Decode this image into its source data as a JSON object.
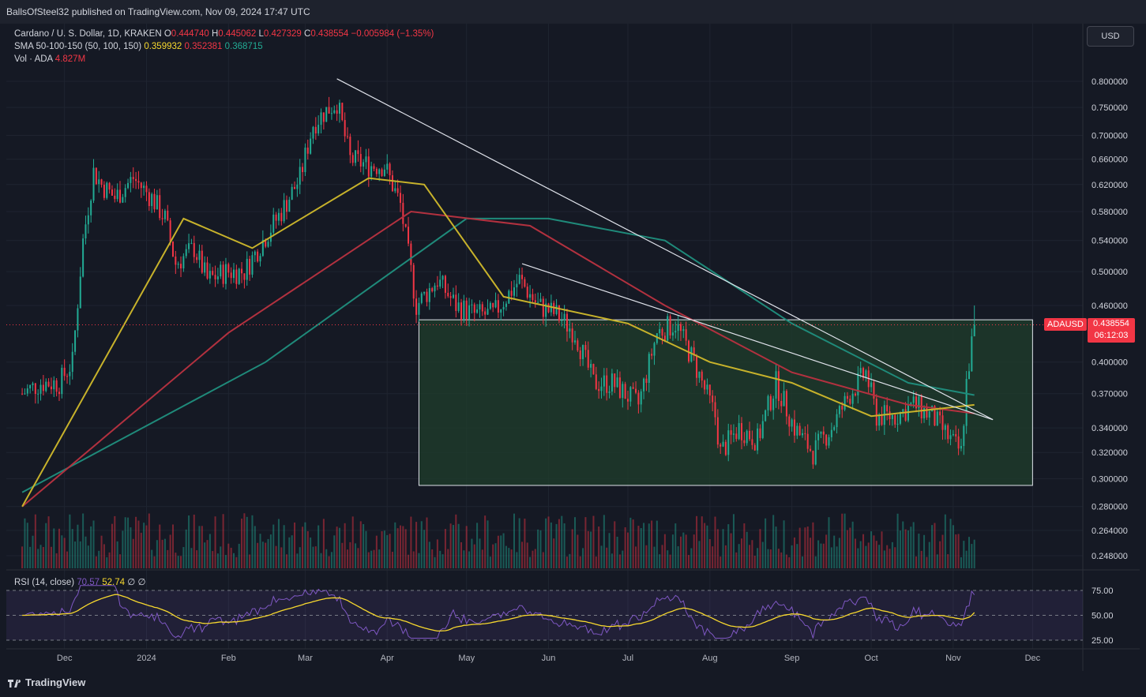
{
  "header": {
    "published": "BallsOfSteel32 published on TradingView.com, Nov 09, 2024 17:47 UTC"
  },
  "legend": {
    "symbol": "Cardano / U. S. Dollar, 1D, KRAKEN",
    "o_label": "O",
    "o": "0.444740",
    "h_label": "H",
    "h": "0.445062",
    "l_label": "L",
    "l": "0.427329",
    "c_label": "C",
    "c": "0.438554",
    "change": "−0.005984 (−1.35%)",
    "sma_label": "SMA 50-100-150 (50, 100, 150)",
    "sma50": "0.359932",
    "sma100": "0.352381",
    "sma150": "0.368715",
    "vol_label": "Vol · ADA",
    "vol": "4.827M"
  },
  "rsi_legend": {
    "label": "RSI (14, close)",
    "rsi": "70.57",
    "ma": "52.74",
    "x1": "∅",
    "x2": "∅"
  },
  "currency_button": "USD",
  "price_badge": {
    "symbol": "ADAUSD",
    "price": "0.438554",
    "countdown": "06:12:03"
  },
  "branding": "TradingView",
  "colors": {
    "up": "#22ab94",
    "down": "#f23645",
    "sma50": "#c7b22b",
    "sma100": "#b2313f",
    "sma150": "#1f8a7a",
    "rsi": "#7e57c2",
    "rsi_ma": "#f7d82e",
    "zone": "#1f3d2b"
  },
  "chart_data": {
    "type": "candlestick",
    "title": "Cardano / U. S. Dollar, 1D, KRAKEN",
    "y_scale": "log",
    "y_ticks": [
      "0.800000",
      "0.750000",
      "0.700000",
      "0.660000",
      "0.620000",
      "0.580000",
      "0.540000",
      "0.500000",
      "0.460000",
      "0.400000",
      "0.370000",
      "0.340000",
      "0.320000",
      "0.300000",
      "0.280000",
      "0.264000",
      "0.248000"
    ],
    "x_ticks": [
      "Dec",
      "2024",
      "Feb",
      "Mar",
      "Apr",
      "May",
      "Jun",
      "Jul",
      "Aug",
      "Sep",
      "Oct",
      "Nov",
      "Dec"
    ],
    "close_series": [
      {
        "x": "2023-11-15",
        "y": 0.37
      },
      {
        "x": "2023-11-22",
        "y": 0.38
      },
      {
        "x": "2023-11-29",
        "y": 0.38
      },
      {
        "x": "2023-12-04",
        "y": 0.4
      },
      {
        "x": "2023-12-08",
        "y": 0.54
      },
      {
        "x": "2023-12-12",
        "y": 0.64
      },
      {
        "x": "2023-12-15",
        "y": 0.62
      },
      {
        "x": "2023-12-20",
        "y": 0.6
      },
      {
        "x": "2023-12-27",
        "y": 0.63
      },
      {
        "x": "2024-01-03",
        "y": 0.6
      },
      {
        "x": "2024-01-08",
        "y": 0.57
      },
      {
        "x": "2024-01-12",
        "y": 0.51
      },
      {
        "x": "2024-01-19",
        "y": 0.53
      },
      {
        "x": "2024-01-24",
        "y": 0.49
      },
      {
        "x": "2024-01-31",
        "y": 0.5
      },
      {
        "x": "2024-02-07",
        "y": 0.5
      },
      {
        "x": "2024-02-14",
        "y": 0.54
      },
      {
        "x": "2024-02-21",
        "y": 0.58
      },
      {
        "x": "2024-02-28",
        "y": 0.63
      },
      {
        "x": "2024-03-04",
        "y": 0.72
      },
      {
        "x": "2024-03-08",
        "y": 0.74
      },
      {
        "x": "2024-03-13",
        "y": 0.76
      },
      {
        "x": "2024-03-18",
        "y": 0.66
      },
      {
        "x": "2024-03-25",
        "y": 0.65
      },
      {
        "x": "2024-03-31",
        "y": 0.65
      },
      {
        "x": "2024-04-06",
        "y": 0.59
      },
      {
        "x": "2024-04-12",
        "y": 0.46
      },
      {
        "x": "2024-04-20",
        "y": 0.49
      },
      {
        "x": "2024-04-27",
        "y": 0.46
      },
      {
        "x": "2024-05-04",
        "y": 0.45
      },
      {
        "x": "2024-05-11",
        "y": 0.45
      },
      {
        "x": "2024-05-21",
        "y": 0.49
      },
      {
        "x": "2024-05-28",
        "y": 0.46
      },
      {
        "x": "2024-06-04",
        "y": 0.45
      },
      {
        "x": "2024-06-11",
        "y": 0.43
      },
      {
        "x": "2024-06-18",
        "y": 0.38
      },
      {
        "x": "2024-06-25",
        "y": 0.38
      },
      {
        "x": "2024-07-05",
        "y": 0.36
      },
      {
        "x": "2024-07-12",
        "y": 0.43
      },
      {
        "x": "2024-07-19",
        "y": 0.44
      },
      {
        "x": "2024-07-26",
        "y": 0.4
      },
      {
        "x": "2024-08-03",
        "y": 0.35
      },
      {
        "x": "2024-08-05",
        "y": 0.32
      },
      {
        "x": "2024-08-12",
        "y": 0.34
      },
      {
        "x": "2024-08-19",
        "y": 0.33
      },
      {
        "x": "2024-08-26",
        "y": 0.38
      },
      {
        "x": "2024-09-02",
        "y": 0.34
      },
      {
        "x": "2024-09-09",
        "y": 0.32
      },
      {
        "x": "2024-09-16",
        "y": 0.34
      },
      {
        "x": "2024-09-23",
        "y": 0.37
      },
      {
        "x": "2024-09-29",
        "y": 0.39
      },
      {
        "x": "2024-10-03",
        "y": 0.35
      },
      {
        "x": "2024-10-10",
        "y": 0.35
      },
      {
        "x": "2024-10-17",
        "y": 0.36
      },
      {
        "x": "2024-10-24",
        "y": 0.35
      },
      {
        "x": "2024-10-31",
        "y": 0.33
      },
      {
        "x": "2024-11-04",
        "y": 0.32
      },
      {
        "x": "2024-11-06",
        "y": 0.38
      },
      {
        "x": "2024-11-09",
        "y": 0.438554
      }
    ],
    "sma50": [
      {
        "x": "2023-11-15",
        "y": 0.28
      },
      {
        "x": "2024-01-15",
        "y": 0.57
      },
      {
        "x": "2024-02-10",
        "y": 0.53
      },
      {
        "x": "2024-03-25",
        "y": 0.63
      },
      {
        "x": "2024-04-15",
        "y": 0.62
      },
      {
        "x": "2024-05-15",
        "y": 0.47
      },
      {
        "x": "2024-07-01",
        "y": 0.44
      },
      {
        "x": "2024-08-01",
        "y": 0.4
      },
      {
        "x": "2024-09-01",
        "y": 0.38
      },
      {
        "x": "2024-10-01",
        "y": 0.35
      },
      {
        "x": "2024-11-09",
        "y": 0.359932
      }
    ],
    "sma100": [
      {
        "x": "2023-11-15",
        "y": 0.28
      },
      {
        "x": "2024-02-01",
        "y": 0.43
      },
      {
        "x": "2024-04-10",
        "y": 0.58
      },
      {
        "x": "2024-05-25",
        "y": 0.56
      },
      {
        "x": "2024-07-15",
        "y": 0.46
      },
      {
        "x": "2024-09-01",
        "y": 0.39
      },
      {
        "x": "2024-10-15",
        "y": 0.36
      },
      {
        "x": "2024-11-09",
        "y": 0.352381
      }
    ],
    "sma150": [
      {
        "x": "2023-11-15",
        "y": 0.29
      },
      {
        "x": "2024-02-15",
        "y": 0.4
      },
      {
        "x": "2024-05-01",
        "y": 0.57
      },
      {
        "x": "2024-06-01",
        "y": 0.57
      },
      {
        "x": "2024-07-15",
        "y": 0.54
      },
      {
        "x": "2024-09-01",
        "y": 0.44
      },
      {
        "x": "2024-10-15",
        "y": 0.38
      },
      {
        "x": "2024-11-09",
        "y": 0.368715
      }
    ],
    "zone": {
      "from": "2024-04-13",
      "to": "2024-12-01",
      "y_top": 0.444,
      "y_bottom": 0.295
    },
    "trendlines": [
      {
        "from": {
          "x": "2024-03-13",
          "y": 0.805
        },
        "to": {
          "x": "2024-11-16",
          "y": 0.347
        }
      },
      {
        "from": {
          "x": "2024-05-22",
          "y": 0.51
        },
        "to": {
          "x": "2024-11-16",
          "y": 0.347
        }
      }
    ],
    "rsi_ticks": [
      "75.00",
      "50.00",
      "25.00"
    ],
    "rsi_last": 70.57,
    "rsi_ma_last": 52.74
  }
}
